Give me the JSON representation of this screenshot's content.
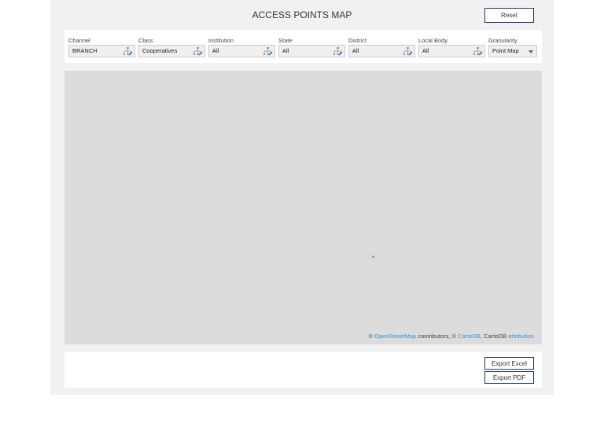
{
  "header": {
    "title": "ACCESS POINTS MAP",
    "reset_label": "Reset"
  },
  "filters": [
    {
      "label": "Channel",
      "value": "BRANCH"
    },
    {
      "label": "Class",
      "value": "Cooperatives"
    },
    {
      "label": "Institution",
      "value": "All"
    },
    {
      "label": "State",
      "value": "All"
    },
    {
      "label": "District",
      "value": "All"
    },
    {
      "label": "Local Body",
      "value": "All"
    }
  ],
  "granularity": {
    "label": "Granularity",
    "value": "Point Map"
  },
  "map": {
    "attr_prefix": "© ",
    "osm": "OpenStreetMap",
    "contrib": " contributors, © ",
    "cartodb": "CartoDB",
    "mid": ", CartoDB ",
    "attribution": "attribution",
    "marker_color": "#e8743b"
  },
  "footer": {
    "export_excel": "Export Excel",
    "export_pdf": "Export PDF"
  }
}
